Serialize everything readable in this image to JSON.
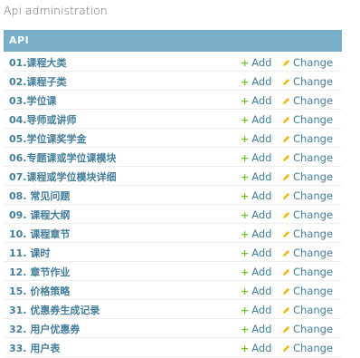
{
  "page": {
    "heading": "Api administration"
  },
  "module": {
    "caption": "API",
    "add_label": "Add",
    "change_label": "Change",
    "models": [
      "01.课程大类",
      "02.课程子类",
      "03.学位课",
      "04.导师或讲师",
      "05.学位课奖学金",
      "06.专题课或学位课模块",
      "07.课程或学位模块详细",
      "08. 常见问题",
      "09. 课程大纲",
      "10. 课程章节",
      "11. 课时",
      "12. 章节作业",
      "15. 价格策略",
      "31. 优惠券生成记录",
      "32. 用户优惠券",
      "33. 用户表"
    ]
  },
  "colors": {
    "caption_bg": "#79aec8",
    "link": "#447e9b",
    "add_icon": "#70bf2b",
    "change_icon": "#efb80b"
  }
}
